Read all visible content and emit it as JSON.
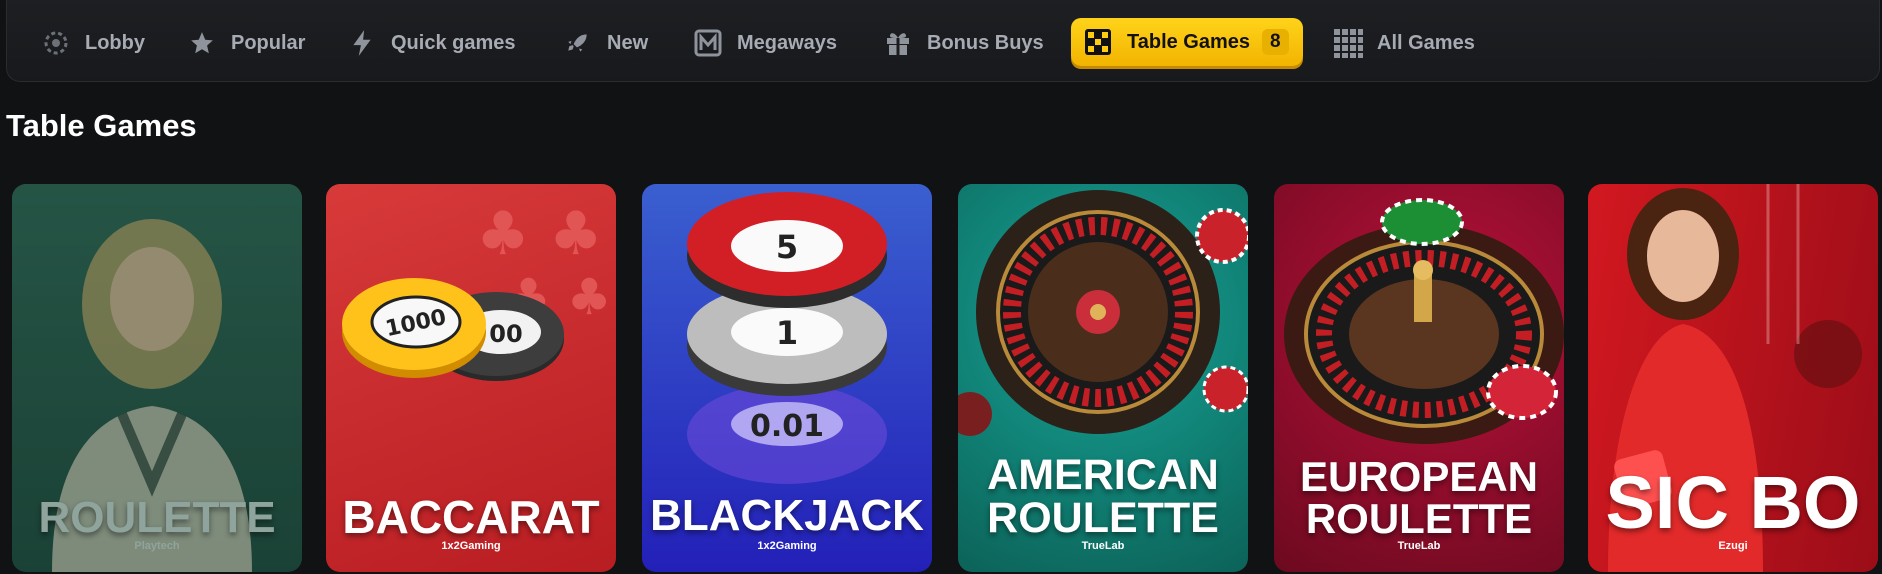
{
  "nav": {
    "items": [
      {
        "label": "Lobby",
        "icon": "lobby-icon"
      },
      {
        "label": "Popular",
        "icon": "star-icon"
      },
      {
        "label": "Quick games",
        "icon": "lightning-icon"
      },
      {
        "label": "New",
        "icon": "rocket-icon"
      },
      {
        "label": "Megaways",
        "icon": "megaways-icon"
      },
      {
        "label": "Bonus Buys",
        "icon": "gift-icon"
      },
      {
        "label": "Table Games",
        "icon": "dice-icon",
        "count": "8",
        "active": true
      },
      {
        "label": "All Games",
        "icon": "grid-icon"
      }
    ]
  },
  "section": {
    "title": "Table Games"
  },
  "games": [
    {
      "title": "ROULETTE",
      "provider": "Playtech",
      "bg": "#1f4a3d"
    },
    {
      "title": "BACCARAT",
      "provider": "1x2Gaming",
      "bg": "#c8262a"
    },
    {
      "title": "BLACKJACK",
      "provider": "1x2Gaming",
      "bg": "#2a35c2"
    },
    {
      "title_lines": [
        "AMERICAN",
        "ROULETTE"
      ],
      "provider": "TrueLab",
      "bg": "#0f7f72"
    },
    {
      "title_lines": [
        "EUROPEAN",
        "ROULETTE"
      ],
      "provider": "TrueLab",
      "bg": "#8e0f2a"
    },
    {
      "title": "SIC BO",
      "provider": "Ezugi",
      "bg": "#b5121c"
    }
  ],
  "chip_values": [
    "1000",
    "00",
    "5",
    "1",
    "0.01"
  ],
  "colors": {
    "accent": "#ffcc12",
    "nav_text": "#a7abb3",
    "background": "#111214"
  }
}
